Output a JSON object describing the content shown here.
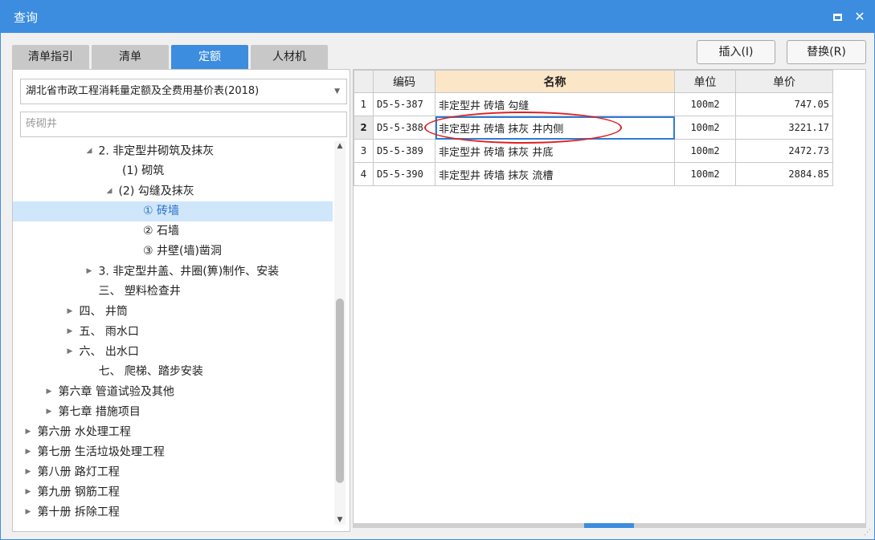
{
  "window": {
    "title": "查询"
  },
  "tabs": [
    {
      "label": "清单指引"
    },
    {
      "label": "清单"
    },
    {
      "label": "定额",
      "active": true
    },
    {
      "label": "人材机"
    }
  ],
  "buttons": {
    "insert": "插入(I)",
    "replace": "替换(R)"
  },
  "library_select": {
    "value": "湖北省市政工程消耗量定额及全费用基价表(2018)"
  },
  "search": {
    "placeholder": "砖砌井"
  },
  "tree": [
    {
      "caret": "◢",
      "label": "2. 非定型井砌筑及抹灰"
    },
    {
      "caret": "",
      "label": "(1) 砌筑"
    },
    {
      "caret": "◢",
      "label": "(2) 勾缝及抹灰"
    },
    {
      "caret": "",
      "label": "① 砖墙",
      "selected": true
    },
    {
      "caret": "",
      "label": "② 石墙"
    },
    {
      "caret": "",
      "label": "③ 井壁(墙)凿洞"
    },
    {
      "caret": "▶",
      "label": "3. 非定型井盖、井圈(箅)制作、安装"
    },
    {
      "caret": "",
      "label": "三、 塑料检查井"
    },
    {
      "caret": "▶",
      "label": "四、 井筒"
    },
    {
      "caret": "▶",
      "label": "五、 雨水口"
    },
    {
      "caret": "▶",
      "label": "六、 出水口"
    },
    {
      "caret": "",
      "label": "七、 爬梯、踏步安装"
    },
    {
      "caret": "▶",
      "label": "第六章 管道试验及其他"
    },
    {
      "caret": "▶",
      "label": "第七章 措施项目"
    },
    {
      "caret": "▶",
      "label": "第六册 水处理工程"
    },
    {
      "caret": "▶",
      "label": "第七册 生活垃圾处理工程"
    },
    {
      "caret": "▶",
      "label": "第八册 路灯工程"
    },
    {
      "caret": "▶",
      "label": "第九册 钢筋工程"
    },
    {
      "caret": "▶",
      "label": "第十册 拆除工程"
    }
  ],
  "table": {
    "headers": {
      "code": "编码",
      "name": "名称",
      "unit": "单位",
      "price": "单价"
    },
    "rows": [
      {
        "idx": "1",
        "code": "D5-5-387",
        "name": "非定型井 砖墙 勾缝",
        "unit": "100m2",
        "price": "747.05"
      },
      {
        "idx": "2",
        "code": "D5-5-388",
        "name": "非定型井 砖墙 抹灰 井内侧",
        "unit": "100m2",
        "price": "3221.17",
        "selected": true
      },
      {
        "idx": "3",
        "code": "D5-5-389",
        "name": "非定型井 砖墙 抹灰 井底",
        "unit": "100m2",
        "price": "2472.73"
      },
      {
        "idx": "4",
        "code": "D5-5-390",
        "name": "非定型井 砖墙 抹灰 流槽",
        "unit": "100m2",
        "price": "2884.85"
      }
    ]
  },
  "colors": {
    "accent": "#3c8ddf",
    "name_header": "#fbe6c7",
    "selected_row": "#cfe6fb",
    "annotation": "#e02020"
  }
}
